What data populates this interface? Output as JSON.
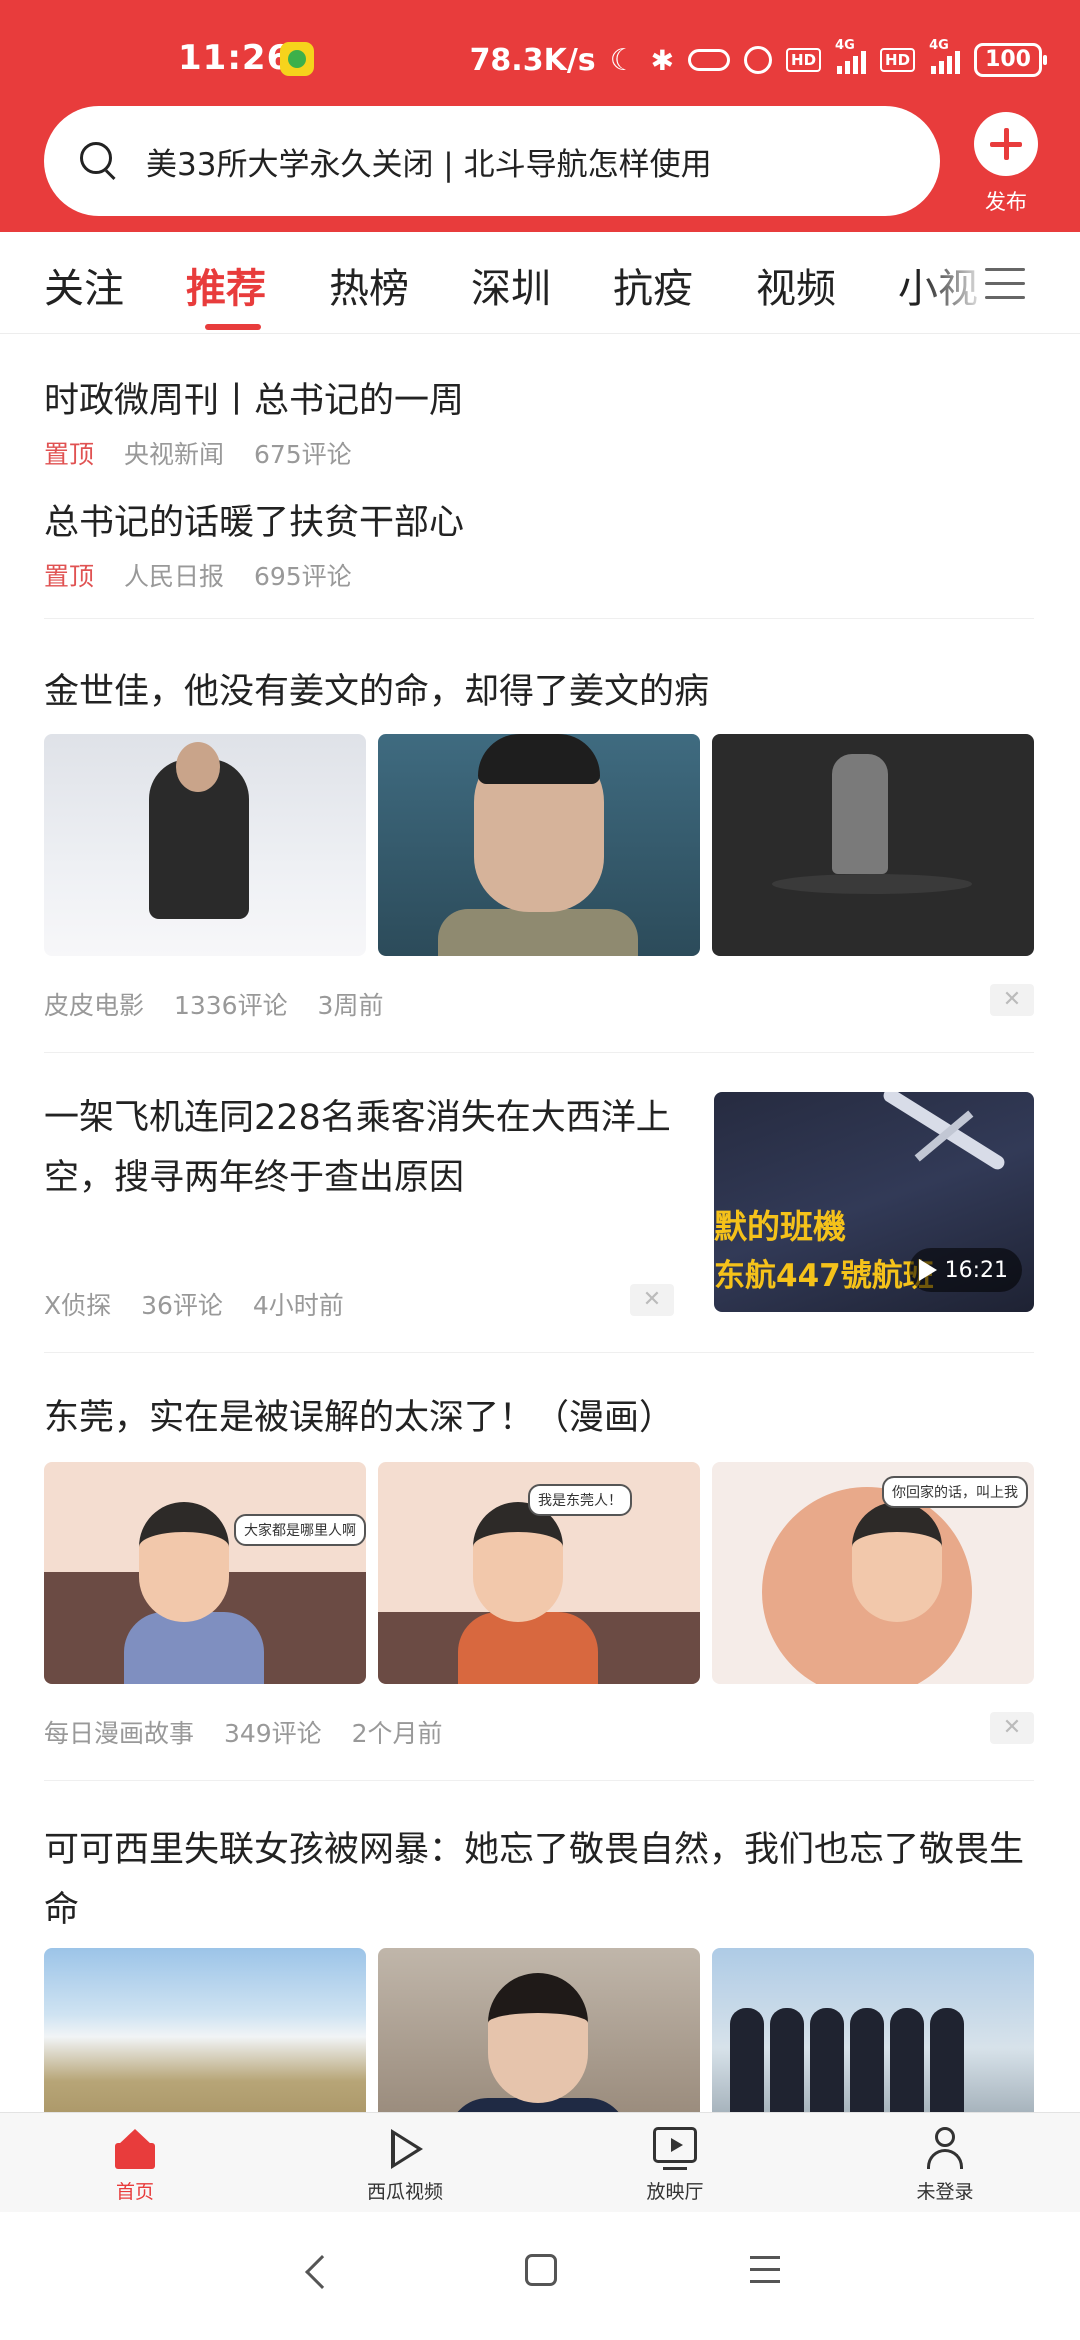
{
  "status_bar": {
    "time": "11:26",
    "net_speed": "78.3K/s",
    "hd1": "HD",
    "hd2": "HD",
    "net1": "4G",
    "net2": "4G",
    "battery": "100"
  },
  "header": {
    "search_text": "美33所大学永久关闭 | 北斗导航怎样使用",
    "publish_label": "发布",
    "accent_color": "#e83c3c"
  },
  "tabs": [
    {
      "label": "关注"
    },
    {
      "label": "推荐",
      "active": true
    },
    {
      "label": "热榜"
    },
    {
      "label": "深圳"
    },
    {
      "label": "抗疫"
    },
    {
      "label": "视频"
    },
    {
      "label": "小视"
    }
  ],
  "feed": {
    "pinned": [
      {
        "title": "时政微周刊丨总书记的一周",
        "tag": "置顶",
        "source": "央视新闻",
        "comments": "675评论"
      },
      {
        "title": "总书记的话暖了扶贫干部心",
        "tag": "置顶",
        "source": "人民日报",
        "comments": "695评论"
      }
    ],
    "articles": [
      {
        "title": "金世佳，他没有姜文的命，却得了姜文的病",
        "source": "皮皮电影",
        "comments": "1336评论",
        "time": "3周前"
      },
      {
        "title": "一架飞机连同228名乘客消失在大西洋上空，搜寻两年终于查出原因",
        "source": "X侦探",
        "comments": "36评论",
        "time": "4小时前",
        "video": {
          "caption1": "默的班機",
          "caption2": "东航447號航班",
          "duration": "16:21"
        }
      },
      {
        "title": "东莞，实在是被误解的太深了！（漫画）",
        "source": "每日漫画故事",
        "comments": "349评论",
        "time": "2个月前",
        "bubbles": [
          "大家都是哪里人啊",
          "我是东莞人！",
          "你回家的话，叫上我"
        ]
      },
      {
        "title": "可可西里失联女孩被网暴：她忘了敬畏自然，我们也忘了敬畏生命"
      }
    ],
    "close_glyph": "✕"
  },
  "bottom_nav": [
    {
      "label": "首页",
      "icon": "home-icon",
      "active": true
    },
    {
      "label": "西瓜视频",
      "icon": "play-icon"
    },
    {
      "label": "放映厅",
      "icon": "tv-icon"
    },
    {
      "label": "未登录",
      "icon": "user-icon"
    }
  ]
}
